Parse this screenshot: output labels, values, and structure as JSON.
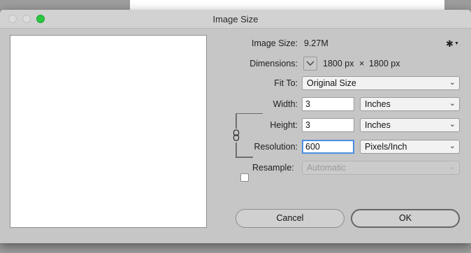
{
  "window": {
    "title": "Image Size"
  },
  "info": {
    "image_size_label": "Image Size:",
    "image_size_value": "9.27M",
    "dimensions_label": "Dimensions:",
    "dim_width": "1800 px",
    "dim_times": "×",
    "dim_height": "1800 px"
  },
  "fit_to": {
    "label": "Fit To:",
    "value": "Original Size"
  },
  "width": {
    "label": "Width:",
    "value": "3",
    "unit": "Inches"
  },
  "height": {
    "label": "Height:",
    "value": "3",
    "unit": "Inches"
  },
  "resolution": {
    "label": "Resolution:",
    "value": "600",
    "unit": "Pixels/Inch"
  },
  "resample": {
    "label": "Resample:",
    "checked": false,
    "value": "Automatic"
  },
  "buttons": {
    "cancel": "Cancel",
    "ok": "OK"
  },
  "icons": {
    "gear": "gear-icon",
    "chevron": "chevron-down-icon",
    "link": "chain-link-icon",
    "traffic_max_color": "#2ac740",
    "focus_color": "#4a8fe0"
  }
}
